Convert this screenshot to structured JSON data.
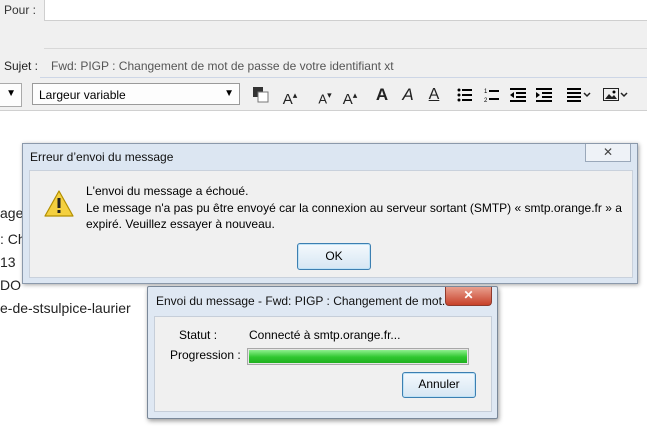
{
  "compose": {
    "to_label": "Pour :",
    "subject_label": "Sujet :",
    "subject_value": "Fwd: PIGP : Changement de mot de passe de votre identifiant xt"
  },
  "format_toolbar": {
    "font_value": "Largeur variable",
    "buttons": {
      "grow_font": "A",
      "shrink_font": "A",
      "bold": "A",
      "italic": "A",
      "underline": "A"
    }
  },
  "background_body": {
    "lines": [
      "age",
      ": Ch",
      "13",
      "DO",
      "e-de-stsulpice-laurier"
    ]
  },
  "error_dialog": {
    "title": "Erreur d’envoi du message",
    "close_glyph": "✕",
    "message_line1": "L'envoi du message a échoué.",
    "message_line2": "Le message n'a pas pu être envoyé car la connexion au serveur sortant (SMTP) « smtp.orange.fr » a expiré. Veuillez essayer à nouveau.",
    "ok_label": "OK"
  },
  "send_dialog": {
    "title": "Envoi du message - Fwd: PIGP : Changement de mot...",
    "close_glyph": "✕",
    "status_label": "Statut :",
    "status_value": "Connecté à smtp.orange.fr...",
    "progress_label": "Progression :",
    "progress_fraction": 1.0,
    "cancel_label": "Annuler"
  },
  "colors": {
    "progress_green": "#2fc72f",
    "dialog_frame": "#dce6f2"
  }
}
